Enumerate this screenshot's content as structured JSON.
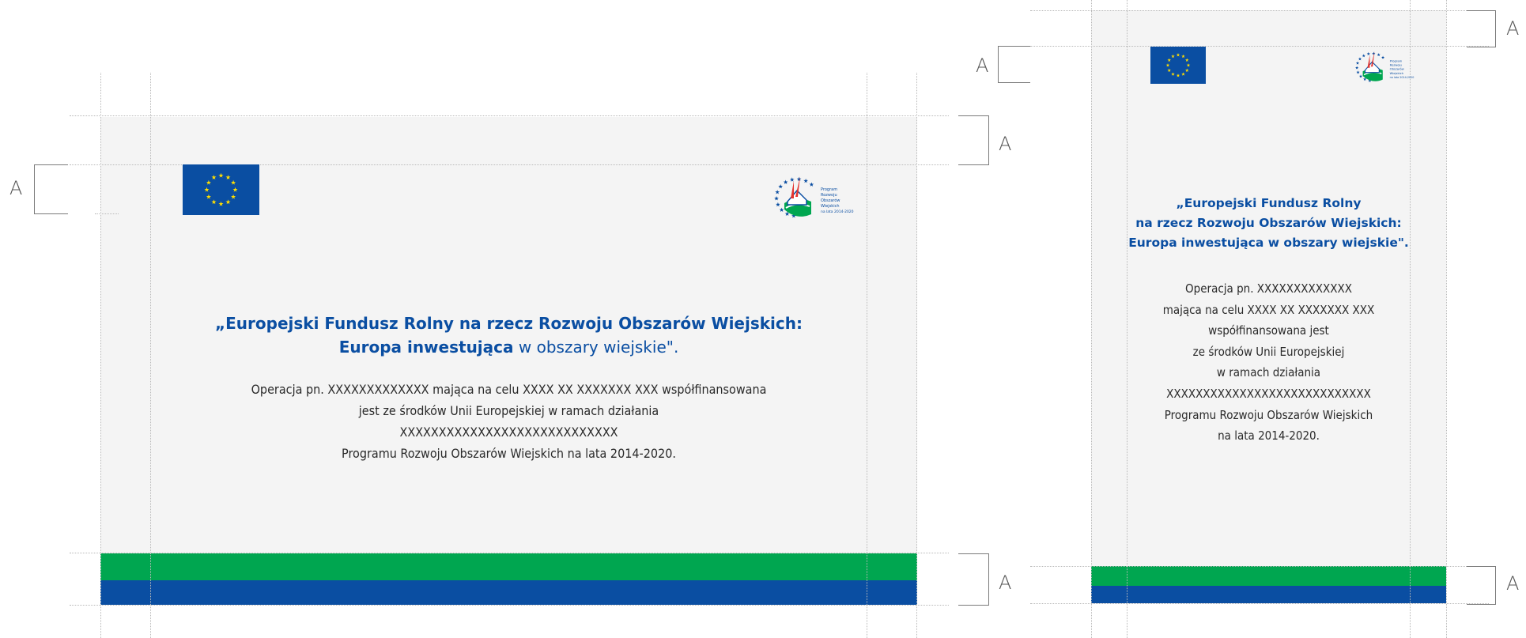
{
  "colors": {
    "panel": "#f4f4f4",
    "green_band": "#00a650",
    "blue_band": "#0a4ea2",
    "title_blue": "#0a4ea2",
    "guide": "#b9b9b9"
  },
  "margin_label": "A",
  "eu_flag_icon": "eu-flag-icon",
  "prow_logo": {
    "icon": "prow-logo-icon",
    "lines": [
      "Program",
      "Rozwoju",
      "Obszarów",
      "Wiejskich",
      "na lata 2014-2020"
    ]
  },
  "landscape": {
    "title_line1": "„Europejski Fundusz Rolny na rzecz Rozwoju Obszarów Wiejskich:",
    "title_line2_bold": "Europa inwestująca",
    "title_line2_rest": " w obszary wiejskie\".",
    "body_lines": [
      "Operacja pn. XXXXXXXXXXXXX mająca na celu XXXX XX XXXXXXX XXX współfinansowana",
      "jest ze środków Unii Europejskiej w ramach działania",
      "XXXXXXXXXXXXXXXXXXXXXXXXXXXX",
      "Programu Rozwoju Obszarów Wiejskich na lata 2014-2020."
    ]
  },
  "portrait": {
    "title_lines": [
      "„Europejski Fundusz Rolny",
      "na rzecz Rozwoju Obszarów Wiejskich:",
      "Europa inwestująca w obszary wiejskie\"."
    ],
    "body_lines": [
      "Operacja pn. XXXXXXXXXXXXX",
      "mająca na celu XXXX XX XXXXXXX XXX",
      "współfinansowana jest",
      "ze środków Unii Europejskiej",
      "w ramach działania",
      "XXXXXXXXXXXXXXXXXXXXXXXXXXXX",
      "Programu Rozwoju Obszarów Wiejskich",
      "na lata 2014-2020."
    ]
  }
}
